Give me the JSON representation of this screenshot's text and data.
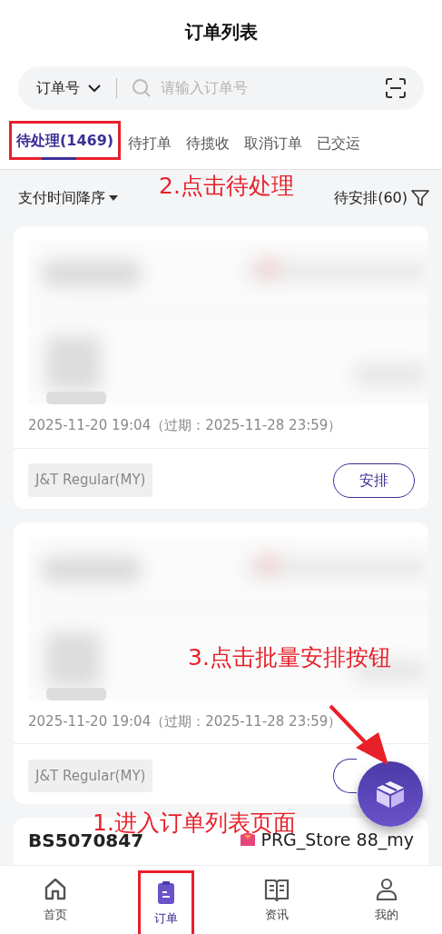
{
  "header": {
    "title": "订单列表"
  },
  "search": {
    "type_label": "订单号",
    "placeholder": "请输入订单号"
  },
  "tabs": [
    {
      "label": "待处理(1469)",
      "selected": true,
      "highlighted": true
    },
    {
      "label": "待打单",
      "selected": false,
      "highlighted": false
    },
    {
      "label": "待揽收",
      "selected": false,
      "highlighted": false
    },
    {
      "label": "取消订单",
      "selected": false,
      "highlighted": false
    },
    {
      "label": "已交运",
      "selected": false,
      "highlighted": false
    }
  ],
  "filter_bar": {
    "sort": "支付时间降序",
    "pending": "待安排(60)"
  },
  "orders": [
    {
      "date": "2025-11-20 19:04（过期：2025-11-28 23:59）",
      "carrier": "J&T Regular(MY)",
      "action": "安排"
    },
    {
      "date": "2025-11-20 19:04（过期：2025-11-28 23:59）",
      "carrier": "J&T Regular(MY)"
    }
  ],
  "next_order": {
    "order_no": "BS5070847",
    "store": "PRG_Store 88_my"
  },
  "bottom_nav": [
    {
      "label": "首页",
      "kind": "home",
      "selected": false,
      "highlighted": false
    },
    {
      "label": "订单",
      "kind": "orders",
      "selected": true,
      "highlighted": true
    },
    {
      "label": "资讯",
      "kind": "news",
      "selected": false,
      "highlighted": false
    },
    {
      "label": "我的",
      "kind": "profile",
      "selected": false,
      "highlighted": false
    }
  ],
  "annotations": [
    {
      "text": "2.点击待处理"
    },
    {
      "text": "3.点击批量安排按钮"
    },
    {
      "text": "1.进入订单列表页面"
    }
  ]
}
